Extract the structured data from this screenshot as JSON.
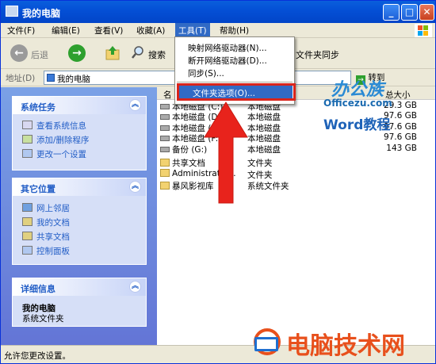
{
  "window": {
    "title": "我的电脑"
  },
  "menubar": {
    "items": [
      "文件(F)",
      "编辑(E)",
      "查看(V)",
      "收藏(A)",
      "工具(T)",
      "帮助(H)"
    ]
  },
  "toolbar": {
    "back": "后退",
    "search": "搜索",
    "sync_partial": "文件夹同步"
  },
  "address": {
    "label": "地址(D)",
    "value": "我的电脑",
    "go": "转到"
  },
  "tools_menu": {
    "items": [
      "映射网络驱动器(N)...",
      "断开网络驱动器(D)...",
      "同步(S)...",
      "文件夹选项(O)..."
    ],
    "highlighted": "文件夹选项(O)..."
  },
  "left": {
    "system_tasks": {
      "title": "系统任务",
      "links": [
        "查看系统信息",
        "添加/删除程序",
        "更改一个设置"
      ]
    },
    "other_places": {
      "title": "其它位置",
      "links": [
        "网上邻居",
        "我的文档",
        "共享文档",
        "控制面板"
      ]
    },
    "details": {
      "title": "详细信息",
      "name": "我的电脑",
      "desc": "系统文件夹"
    }
  },
  "columns": {
    "name": "名",
    "type": "",
    "total": "总大小"
  },
  "rows": [
    {
      "name": "本地磁盘 (C:)",
      "type": "本地磁盘",
      "size": "29.3 GB"
    },
    {
      "name": "本地磁盘 (D:)",
      "type": "本地磁盘",
      "size": "97.6 GB"
    },
    {
      "name": "本地磁盘 (E:)",
      "type": "本地磁盘",
      "size": "97.6 GB"
    },
    {
      "name": "本地磁盘 (F:)",
      "type": "本地磁盘",
      "size": "97.6 GB"
    },
    {
      "name": "备份 (G:)",
      "type": "本地磁盘",
      "size": "143 GB"
    },
    {
      "name": "共享文档",
      "type": "文件夹",
      "size": ""
    },
    {
      "name": "Administrator...",
      "type": "文件夹",
      "size": ""
    },
    {
      "name": "暴风影视库",
      "type": "系统文件夹",
      "size": ""
    }
  ],
  "status": {
    "text": "允许您更改设置。"
  },
  "watermarks": {
    "top_title": "办公族",
    "top_url": "Officezu.com",
    "top_sub": "Word教程",
    "bottom": "电脑技术网"
  },
  "colors": {
    "accent": "#316ac5",
    "title_blue": "#0450d6",
    "highlight_red": "#d9251c"
  }
}
